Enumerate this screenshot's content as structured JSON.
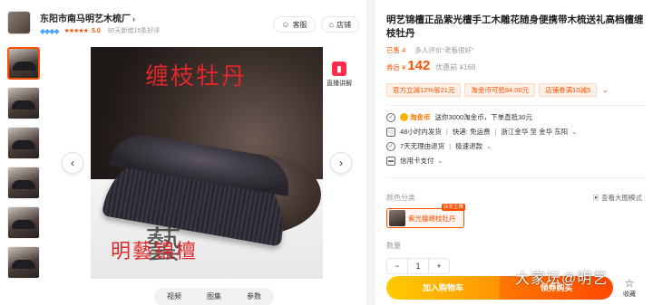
{
  "shop": {
    "name": "东阳市南马明艺木梳厂",
    "chevron": "›",
    "diamonds": "◆◆◆◆",
    "stars": "★★★★★",
    "score": "5.0",
    "good_rate": "90天新增16条好评",
    "service_btn": "客服",
    "store_btn": "店铺",
    "service_icon": "☺",
    "store_icon": "⌂"
  },
  "gallery": {
    "watermark_top": "缠枝牡丹",
    "watermark_bottom": "明藝锦檀",
    "watermark_seal": "藝",
    "prev": "‹",
    "next": "›",
    "explain_label": "直播讲解",
    "explain_icon": "▮",
    "tabs": [
      "视频",
      "图集",
      "参数"
    ]
  },
  "product": {
    "title": "明艺锦檀正品紫光檀手工木雕花随身便携带木梳送礼高档檀缠枝牡丹",
    "sold": "已售 4",
    "reviews": "多人评价\"老板很好\"",
    "price_label": "券后 ¥",
    "price_now": "142",
    "price_orig": "优惠前 ¥168",
    "promos": [
      "官方立减12%省21元",
      "淘金币可抵84.00元",
      "店铺券满10减5"
    ],
    "promo_more": "⌄"
  },
  "services": {
    "taojinbi_label": "淘金币",
    "taojinbi_text": "送你3000淘金币，下单直抵30元",
    "ship_time": "48小时内发货",
    "delivery": "快递: 免运费",
    "route": "浙江金华 至 金华 东阳",
    "returns": "7天无理由退货",
    "refund": "极速退款",
    "credit": "信用卡支付"
  },
  "sku": {
    "section_label": "颜色分类",
    "big_view": "▣ 查看大图模式",
    "option": "紫光檀缠枝牡丹",
    "badge": "店长主推"
  },
  "quantity": {
    "label": "数量",
    "minus": "−",
    "value": "1",
    "plus": "+"
  },
  "actions": {
    "add_cart": "加入购物车",
    "buy_now": "领券购买",
    "favorite": "收藏",
    "favorite_icon": "☆"
  },
  "forum_watermark": "大家坛@明艺"
}
